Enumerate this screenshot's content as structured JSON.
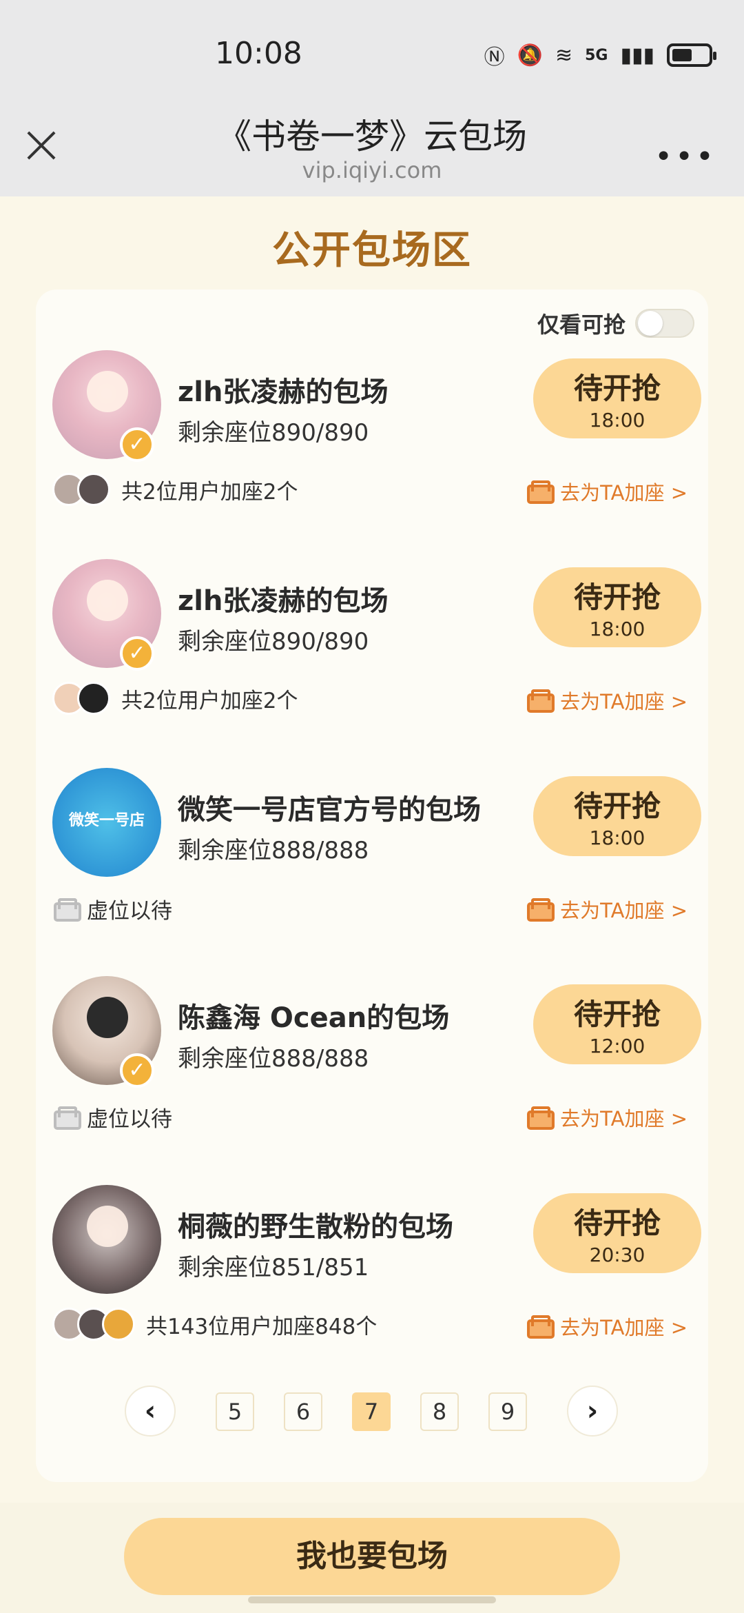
{
  "status_bar": {
    "time": "10:08",
    "network": "5G"
  },
  "header": {
    "title": "《书卷一梦》云包场",
    "url": "vip.iqiyi.com"
  },
  "section_title": "公开包场区",
  "filter": {
    "label": "仅看可抢",
    "enabled": false
  },
  "cards": [
    {
      "title": "zlh张凌赫的包场",
      "seats": "剩余座位890/890",
      "button_label": "待开抢",
      "button_time": "18:00",
      "participants_text": "共2位用户加座2个",
      "add_seat": "去为TA加座 >",
      "verified": true
    },
    {
      "title": "zlh张凌赫的包场",
      "seats": "剩余座位890/890",
      "button_label": "待开抢",
      "button_time": "18:00",
      "participants_text": "共2位用户加座2个",
      "add_seat": "去为TA加座 >",
      "verified": true
    },
    {
      "title": "微笑一号店官方号的包场",
      "seats": "剩余座位888/888",
      "button_label": "待开抢",
      "button_time": "18:00",
      "empty_text": "虚位以待",
      "add_seat": "去为TA加座 >",
      "verified": false,
      "avatar_text": "微笑一号店"
    },
    {
      "title": "陈鑫海 Ocean的包场",
      "seats": "剩余座位888/888",
      "button_label": "待开抢",
      "button_time": "12:00",
      "empty_text": "虚位以待",
      "add_seat": "去为TA加座 >",
      "verified": true
    },
    {
      "title": "桐薇的野生散粉的包场",
      "seats": "剩余座位851/851",
      "button_label": "待开抢",
      "button_time": "20:30",
      "participants_text": "共143位用户加座848个",
      "add_seat": "去为TA加座 >",
      "verified": false
    }
  ],
  "pagination": {
    "prev": "‹",
    "next": "›",
    "pages": [
      "5",
      "6",
      "7",
      "8",
      "9"
    ],
    "current": "7"
  },
  "cta_label": "我也要包场",
  "colors": {
    "accent": "#fcd795",
    "title": "#a86a1f",
    "link": "#e07a2a",
    "background": "#fbf7e8"
  }
}
